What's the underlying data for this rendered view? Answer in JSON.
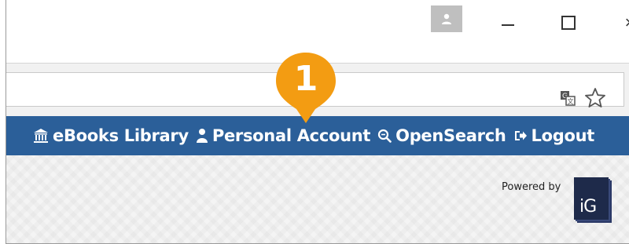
{
  "window": {
    "controls": {
      "minimize_icon": "minimize-icon",
      "maximize_icon": "maximize-icon",
      "close_glyph": "×"
    }
  },
  "navbar": {
    "color": "#2b5f99",
    "items": [
      {
        "label": "eBooks Library",
        "icon": "library-icon"
      },
      {
        "label": "Personal Account",
        "icon": "user-icon"
      },
      {
        "label": "OpenSearch",
        "icon": "search-icon"
      },
      {
        "label": "Logout",
        "icon": "logout-icon"
      }
    ]
  },
  "footer": {
    "powered_by": "Powered by",
    "logo_text": "iG"
  },
  "callout": {
    "number": "1",
    "color": "#f39c12"
  }
}
